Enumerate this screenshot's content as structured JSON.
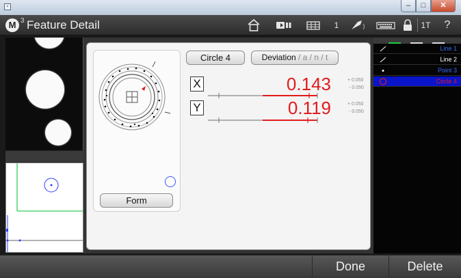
{
  "app": {
    "logo_letter": "M",
    "logo_sup": "3",
    "title": "Feature Detail"
  },
  "header": {
    "count": "1",
    "mode": "1T",
    "help": "?"
  },
  "feature": {
    "name_button": "Circle 4",
    "deviation_label": "Deviation",
    "deviation_options": " / a / n / t",
    "form_button": "Form"
  },
  "axes": [
    {
      "axis": "X",
      "value": "0.143",
      "tol_plus": "+ 0.050",
      "tol_minus": "- 0.050"
    },
    {
      "axis": "Y",
      "value": "0.119",
      "tol_plus": "+ 0.050",
      "tol_minus": "- 0.050"
    }
  ],
  "features_list": [
    {
      "name": "Line 1",
      "icon": "line-icon",
      "color": "#3a6cff"
    },
    {
      "name": "Line 2",
      "icon": "line-icon",
      "color": "#ffffff"
    },
    {
      "name": "Point 3",
      "icon": "point-icon",
      "color": "#3a6cff"
    },
    {
      "name": "Circle 4",
      "icon": "circle-icon",
      "color": "#e21b1b"
    }
  ],
  "footer": {
    "done": "Done",
    "delete": "Delete"
  },
  "colors": {
    "accent_red": "#e21b1b",
    "selection_blue": "#0a14c8",
    "dark_bg": "#1a1a1a",
    "green_lines": "#22cc44"
  }
}
